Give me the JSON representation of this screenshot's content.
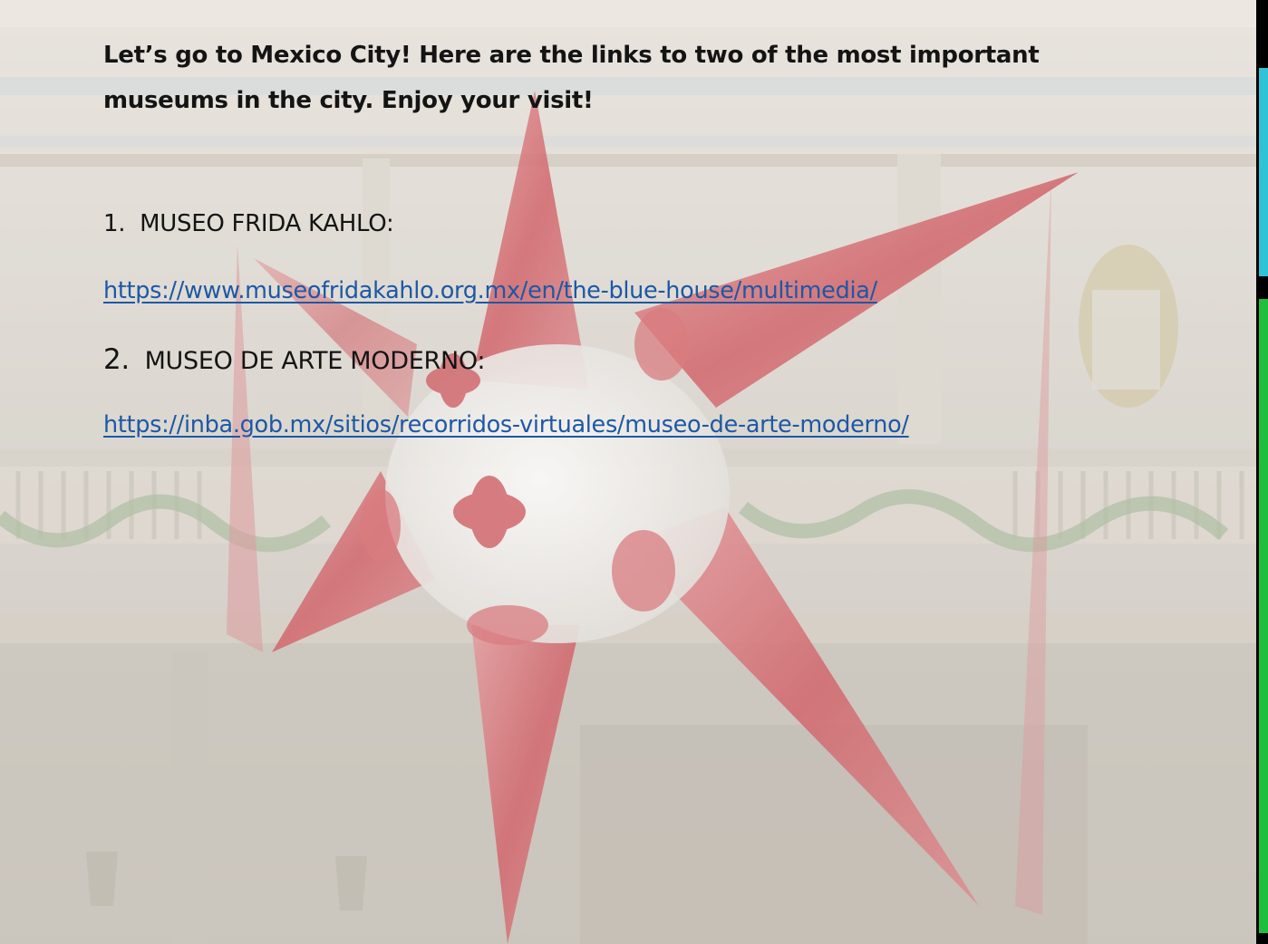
{
  "slide": {
    "intro": "Let’s go to Mexico City!  Here are the links to two of the most important museums in the city.  Enjoy your visit!",
    "items": [
      {
        "number": "1.",
        "title": "MUSEO FRIDA KAHLO:",
        "url": "https://www.museofridakahlo.org.mx/en/the-blue-house/multimedia/"
      },
      {
        "number": "2.",
        "title": "MUSEO DE ARTE MODERNO:",
        "url": "https://inba.gob.mx/sitios/recorridos-virtuales/museo-de-arte-moderno/"
      }
    ],
    "background_icon": "pinata-photo",
    "colors": {
      "link": "#1d58a6",
      "text": "#141414",
      "pinata": "#c7343f",
      "edge_teal": "#2ec3d6",
      "edge_green": "#1fbf3e"
    }
  }
}
